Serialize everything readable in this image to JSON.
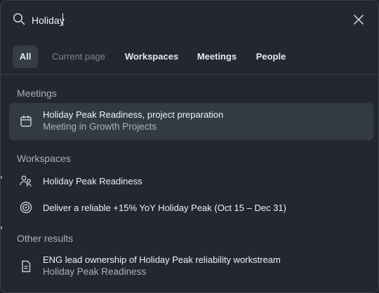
{
  "search": {
    "value": "Holiday",
    "search_icon": "search-icon",
    "close_icon": "close-icon"
  },
  "tabs": [
    {
      "label": "All"
    },
    {
      "label": "Current page"
    },
    {
      "label": "Workspaces"
    },
    {
      "label": "Meetings"
    },
    {
      "label": "People"
    }
  ],
  "sections": {
    "meetings": {
      "title": "Meetings",
      "items": [
        {
          "icon": "calendar-icon",
          "title": "Holiday Peak Readiness, project preparation",
          "subtitle": "Meeting in Growth Projects"
        }
      ]
    },
    "workspaces": {
      "title": "Workspaces",
      "items": [
        {
          "icon": "people-icon",
          "title": "Holiday Peak Readiness"
        },
        {
          "icon": "target-icon",
          "title": "Deliver a reliable +15% YoY Holiday Peak (Oct 15 – Dec 31)"
        }
      ]
    },
    "other": {
      "title": "Other results",
      "items": [
        {
          "icon": "document-icon",
          "title": "ENG lead ownership of Holiday Peak reliability workstream",
          "subtitle": "Holiday Peak Readiness"
        }
      ]
    }
  },
  "colors": {
    "background": "#232830",
    "selected_row": "#343a44",
    "active_tab": "#363c46",
    "text_primary": "#eef1f5",
    "text_secondary": "#aab1bc",
    "text_dim": "#7d8591"
  }
}
